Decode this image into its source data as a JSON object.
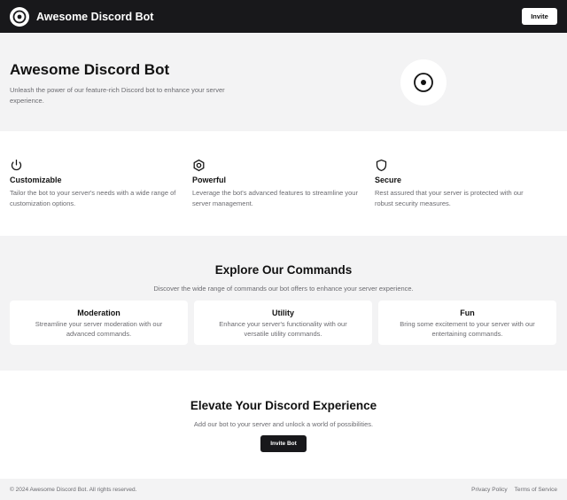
{
  "header": {
    "brand_name": "Awesome Discord Bot",
    "invite_label": "Invite"
  },
  "hero": {
    "title": "Awesome Discord Bot",
    "subtitle": "Unleash the power of our feature-rich Discord bot to enhance your server experience."
  },
  "features": [
    {
      "icon": "power-icon",
      "title": "Customizable",
      "description": "Tailor the bot to your server's needs with a wide range of customization options."
    },
    {
      "icon": "hexagon-icon",
      "title": "Powerful",
      "description": "Leverage the bot's advanced features to streamline your server management."
    },
    {
      "icon": "shield-icon",
      "title": "Secure",
      "description": "Rest assured that your server is protected with our robust security measures."
    }
  ],
  "commands": {
    "title": "Explore Our Commands",
    "subtitle": "Discover the wide range of commands our bot offers to enhance your server experience.",
    "cards": [
      {
        "title": "Moderation",
        "description": "Streamline your server moderation with our advanced commands."
      },
      {
        "title": "Utility",
        "description": "Enhance your server's functionality with our versatile utility commands."
      },
      {
        "title": "Fun",
        "description": "Bring some excitement to your server with our entertaining commands."
      }
    ]
  },
  "cta": {
    "title": "Elevate Your Discord Experience",
    "subtitle": "Add our bot to your server and unlock a world of possibilities.",
    "button_label": "Invite Bot"
  },
  "footer": {
    "copyright": "© 2024 Awesome Discord Bot. All rights reserved.",
    "links": [
      "Privacy Policy",
      "Terms of Service"
    ]
  },
  "colors": {
    "dark": "#18181b",
    "light_bg": "#f3f3f4",
    "muted_text": "#6b6b70"
  }
}
